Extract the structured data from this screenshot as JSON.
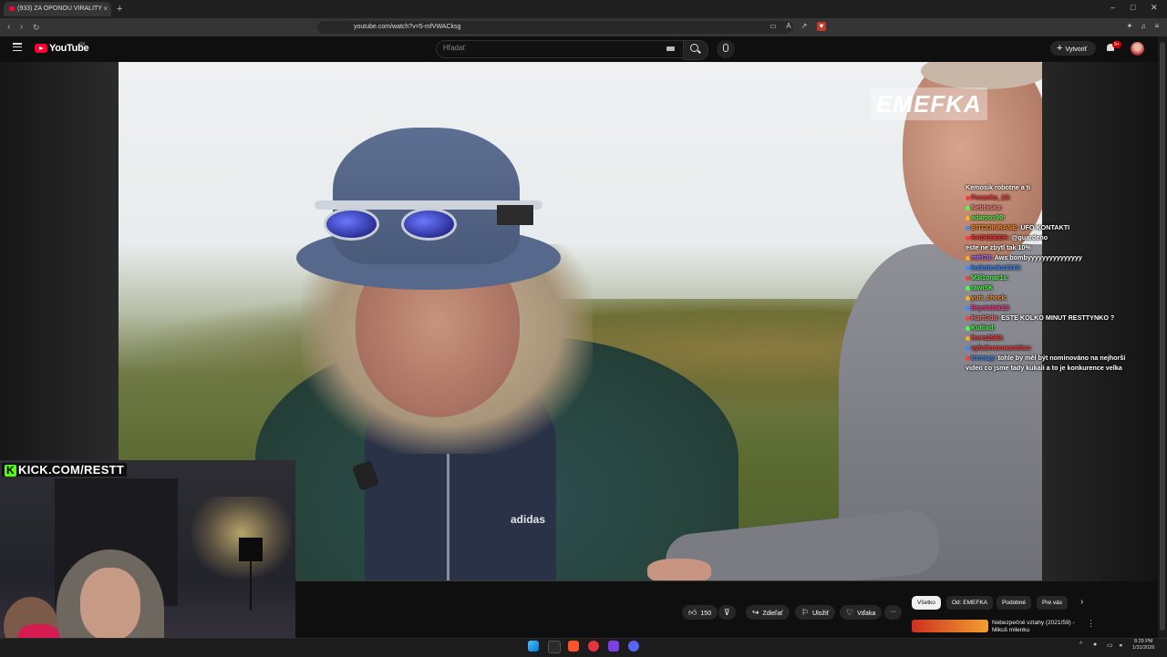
{
  "browser": {
    "tab_title": "(933) ZA OPONOU VIRALITY",
    "tab_close": "×",
    "new_tab": "+",
    "url": "youtube.com/watch?v=5-mfVWACksg",
    "window_controls": [
      "–",
      "□",
      "✕"
    ]
  },
  "youtube": {
    "logo_text": "YouTube",
    "country": "SK",
    "search_placeholder": "Hľadať",
    "create_label": "Vytvoriť",
    "notifications": "9+"
  },
  "video": {
    "watermark": "EMEFKA",
    "shirt_logo": "adidas"
  },
  "chat": [
    {
      "user": "",
      "msg": "Kemosik robotne a ti",
      "color": "#ffffff"
    },
    {
      "user": "Pesanka_13:",
      "msg": "",
      "color": "#ff3a3a"
    },
    {
      "user": "Nebbisko:",
      "msg": "",
      "color": "#ff8a8a"
    },
    {
      "user": "adamos99:",
      "msg": "",
      "color": "#4cff4c"
    },
    {
      "user": "BITCOINRANE:",
      "msg": "UFO KONTAKTI",
      "color": "#ff8c1a"
    },
    {
      "user": "RADEEEEK:",
      "msg": "@guardeno",
      "color": "#ff3030"
    },
    {
      "user": "",
      "msg": "este ne zbytl tak 10%",
      "color": "#ffffff"
    },
    {
      "user": "mfrl78:",
      "msg": "Aws bombyyyyyyyyyyyyyyy",
      "color": "#b070ff"
    },
    {
      "user": "leskotesko1313:",
      "msg": "",
      "color": "#3a8bff"
    },
    {
      "user": "M3l1onar1s:",
      "msg": "",
      "color": "#4cff4c"
    },
    {
      "user": "rawiSK",
      "msg": "",
      "color": "#4cff4c"
    },
    {
      "user": "yuri_check:",
      "msg": "",
      "color": "#ff8c1a"
    },
    {
      "user": "Bryntalak12:",
      "msg": "",
      "color": "#ff3a8a"
    },
    {
      "user": "HartGdo:",
      "msg": "ESTE KOLKO MINUT RESTTYNKO ?",
      "color": "#ff6a6a"
    },
    {
      "user": "Kutlixd:",
      "msg": "",
      "color": "#4cff4c"
    },
    {
      "user": "feero2588:",
      "msg": "",
      "color": "#ff3a3a"
    },
    {
      "user": "vybalenonwanidso:",
      "msg": "",
      "color": "#ff3a3a"
    },
    {
      "user": "trrrmay:",
      "msg": "tohle by měl být nominováno na nejhorší video co jsme tady kukali a to je konkurence velka",
      "color": "#3a8bff"
    }
  ],
  "overlay": {
    "kick_mark": "K",
    "kick_url": "KICK.COM/RESTT"
  },
  "actions": {
    "likes": "150",
    "share": "Zdieľať",
    "save": "Uložiť",
    "thanks": "Vďaka",
    "more": "···"
  },
  "chips": [
    "Všetko",
    "Od: EMEFKA",
    "Podobné",
    "Pre vás"
  ],
  "recommendation": {
    "title": "Nebezpečné vztahy (2021/59) - Mikuš milenku"
  },
  "taskbar": {
    "time": "8:29 PM",
    "date": "1/31/2026"
  }
}
